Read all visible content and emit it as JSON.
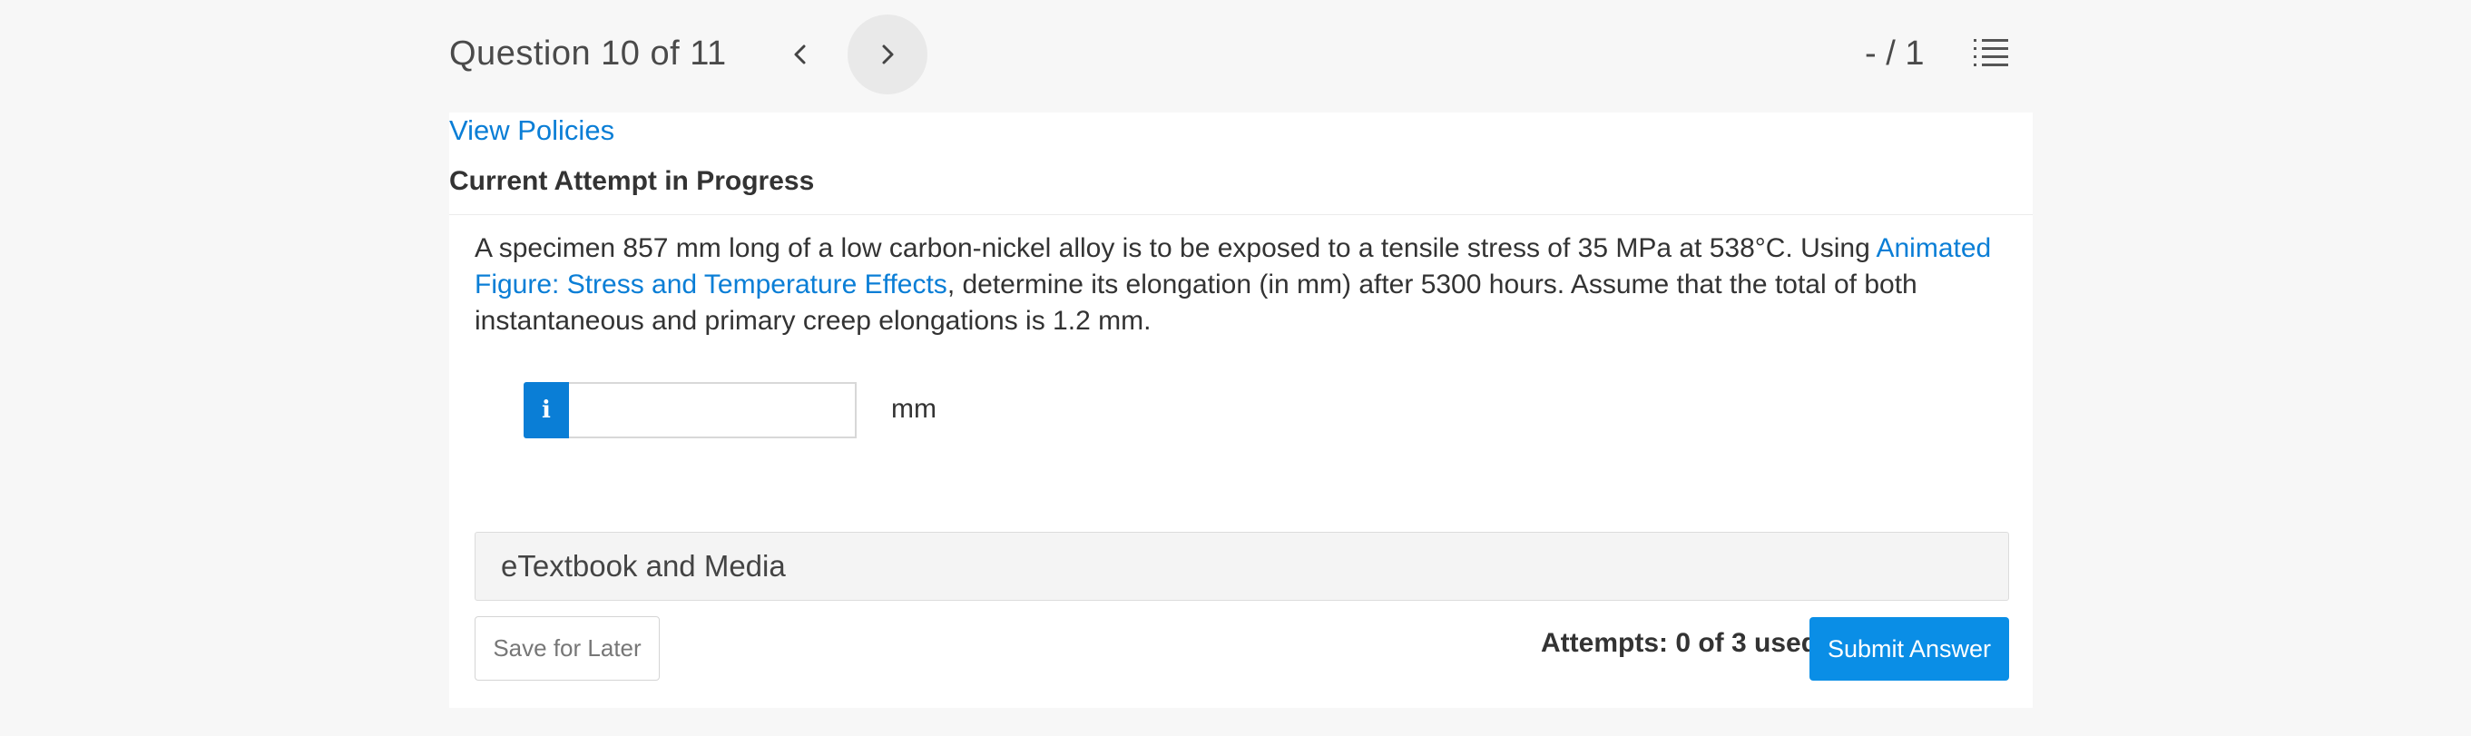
{
  "header": {
    "question_label": "Question 10 of 11",
    "score": "- / 1"
  },
  "links": {
    "view_policies": "View Policies"
  },
  "attempt": {
    "heading": "Current Attempt in Progress",
    "attempts_used": "Attempts: 0 of 3 used"
  },
  "question": {
    "text_before": "A specimen 857 mm long of a low carbon-nickel alloy is to be exposed to a tensile stress of 35 MPa at 538°C. Using ",
    "link_text": "Animated Figure: Stress and Temperature Effects",
    "text_after": ", determine its elongation (in mm) after 5300 hours. Assume that the total of both instantaneous and primary creep elongations is 1.2 mm."
  },
  "answer": {
    "info_glyph": "i",
    "value": "",
    "unit": "mm"
  },
  "resources": {
    "etextbook_label": "eTextbook and Media"
  },
  "buttons": {
    "save_label": "Save for Later",
    "submit_label": "Submit Answer"
  },
  "icons": {
    "prev": "chevron-left-icon",
    "next": "chevron-right-icon",
    "list": "numbered-list-icon"
  },
  "colors": {
    "link": "#0a7ed6",
    "primary_button": "#0a8ee6",
    "page_background": "#f7f7f7",
    "panel_background": "#ffffff"
  }
}
